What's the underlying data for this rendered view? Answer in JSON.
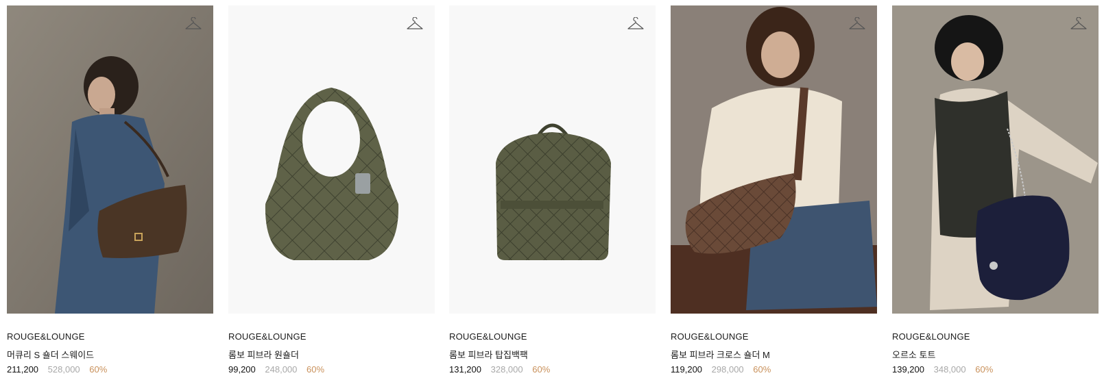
{
  "products": [
    {
      "brand": "ROUGE&LOUNGE",
      "name": "머큐리 S 숄더 스웨이드",
      "price": "211,200",
      "original_price": "528,000",
      "discount": "60%",
      "image": "model-denim-brown-suede-shoulder-bag",
      "wishlist_icon": "hanger-icon"
    },
    {
      "brand": "ROUGE&LOUNGE",
      "name": "롬보 피브라 원숄더",
      "price": "99,200",
      "original_price": "248,000",
      "discount": "60%",
      "image": "olive-quilted-hobo-bag",
      "wishlist_icon": "hanger-icon"
    },
    {
      "brand": "ROUGE&LOUNGE",
      "name": "롬보 피브라 탑집백팩",
      "price": "131,200",
      "original_price": "328,000",
      "discount": "60%",
      "image": "olive-quilted-backpack",
      "wishlist_icon": "hanger-icon"
    },
    {
      "brand": "ROUGE&LOUNGE",
      "name": "롬보 피브라 크로스 숄더 M",
      "price": "119,200",
      "original_price": "298,000",
      "discount": "60%",
      "image": "model-cream-sweater-brown-crossbody",
      "wishlist_icon": "hanger-icon"
    },
    {
      "brand": "ROUGE&LOUNGE",
      "name": "오르소 토트",
      "price": "139,200",
      "original_price": "348,000",
      "discount": "60%",
      "image": "model-bucket-hat-navy-fur-tote",
      "wishlist_icon": "hanger-icon"
    }
  ],
  "colors": {
    "discount": "#c9915b",
    "original_price": "#a8a8a8",
    "text": "#1a1a1a"
  }
}
